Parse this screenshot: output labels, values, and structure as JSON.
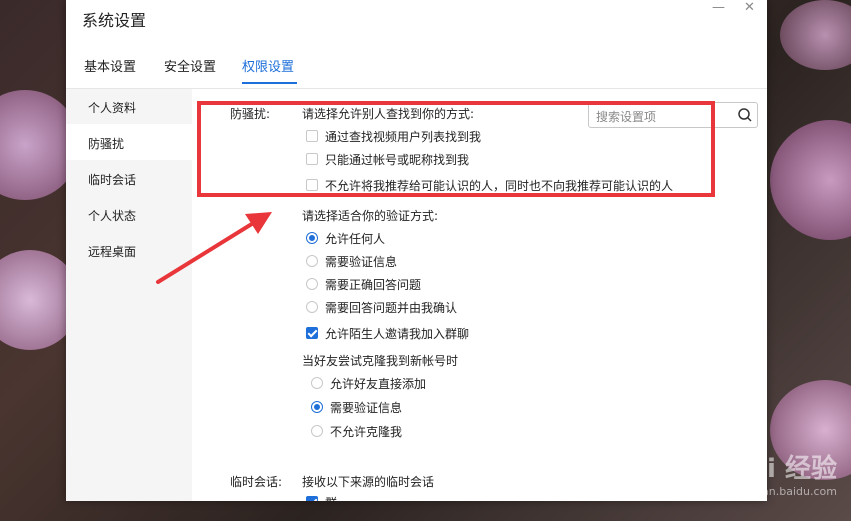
{
  "window": {
    "title": "系统设置",
    "minimize_glyph": "—",
    "close_glyph": "✕"
  },
  "tabs": [
    {
      "label": "基本设置"
    },
    {
      "label": "安全设置"
    },
    {
      "label": "权限设置",
      "active": true
    }
  ],
  "search": {
    "placeholder": "搜索设置项"
  },
  "sidebar": {
    "items": [
      {
        "label": "个人资料"
      },
      {
        "label": "防骚扰",
        "active": true
      },
      {
        "label": "临时会话"
      },
      {
        "label": "个人状态"
      },
      {
        "label": "远程桌面"
      }
    ]
  },
  "anti_harassment": {
    "section_label": "防骚扰:",
    "find_prompt": "请选择允许别人查找到你的方式:",
    "find_options": [
      {
        "label": "通过查找视频用户列表找到我",
        "checked": false
      },
      {
        "label": "只能通过帐号或昵称找到我",
        "checked": false
      },
      {
        "label": "不允许将我推荐给可能认识的人，同时也不向我推荐可能认识的人",
        "checked": false
      }
    ],
    "verify_prompt": "请选择适合你的验证方式:",
    "verify_options": [
      {
        "label": "允许任何人",
        "selected": true
      },
      {
        "label": "需要验证信息",
        "selected": false
      },
      {
        "label": "需要正确回答问题",
        "selected": false
      },
      {
        "label": "需要回答问题并由我确认",
        "selected": false
      }
    ],
    "group_invite": {
      "label": "允许陌生人邀请我加入群聊",
      "checked": true
    },
    "clone_prompt": "当好友尝试克隆我到新帐号时",
    "clone_options": [
      {
        "label": "允许好友直接添加",
        "selected": false
      },
      {
        "label": "需要验证信息",
        "selected": true
      },
      {
        "label": "不允许克隆我",
        "selected": false
      }
    ]
  },
  "temp_chat": {
    "section_label": "临时会话:",
    "prompt": "接收以下来源的临时会话",
    "first_option_label": "群"
  },
  "colors": {
    "accent": "#1e6fd9",
    "annotation_red": "#e8363a"
  },
  "watermark": {
    "text": "Bai 经验",
    "subtext": "jingyan.baidu.com"
  }
}
